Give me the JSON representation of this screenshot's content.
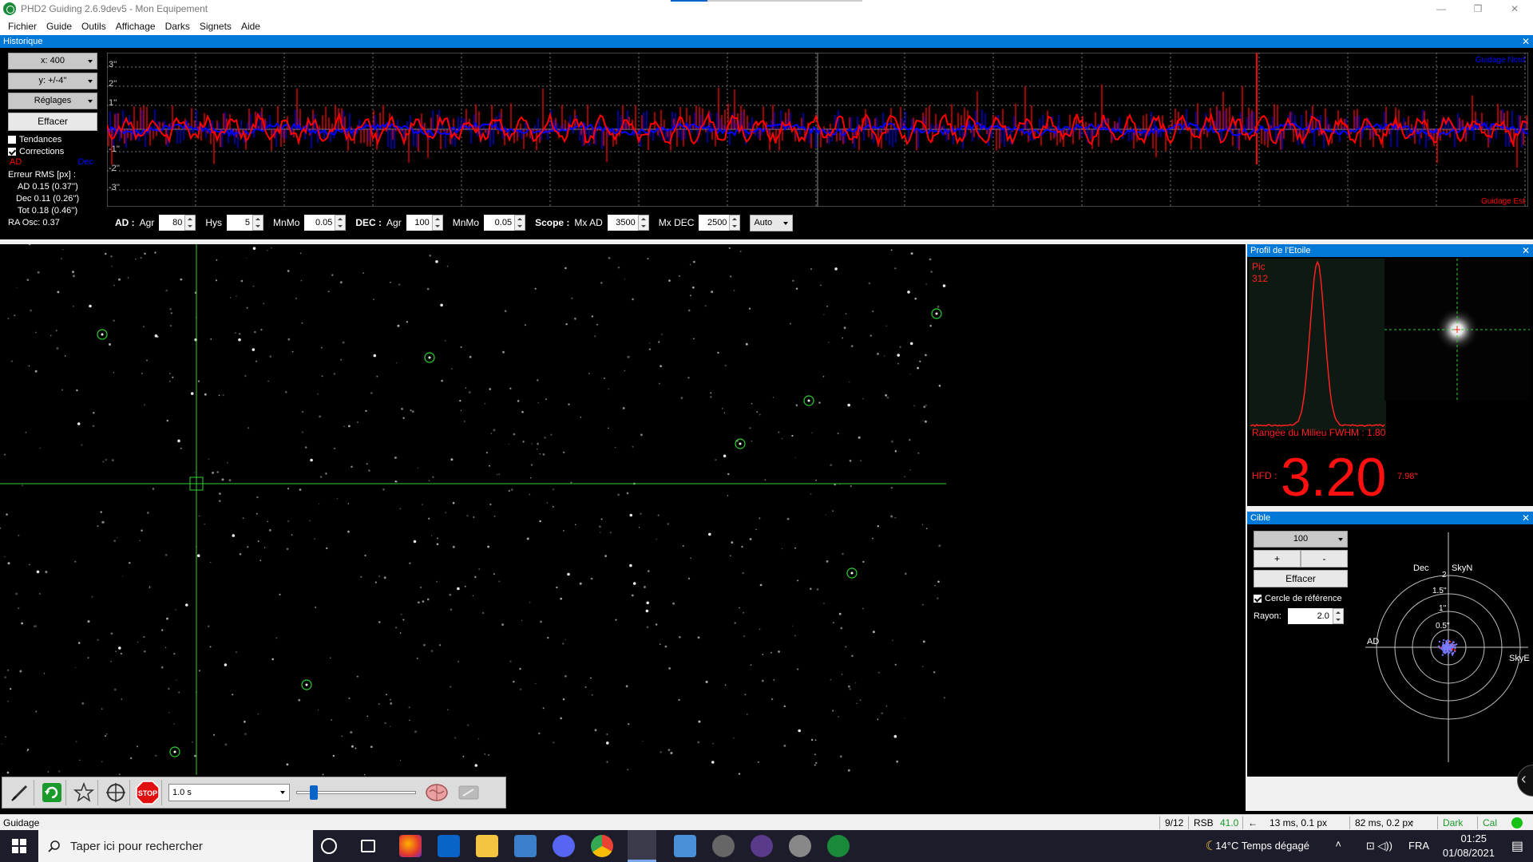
{
  "window": {
    "title": "PHD2 Guiding 2.6.9dev5 - Mon Equipement",
    "controls": [
      "—",
      "❐",
      "✕"
    ]
  },
  "menu": [
    "Fichier",
    "Guide",
    "Outils",
    "Affichage",
    "Darks",
    "Signets",
    "Aide"
  ],
  "history": {
    "title": "Historique",
    "close": "✕",
    "x_scale": "x: 400",
    "y_scale": "y: +/-4''",
    "settings": "Réglages",
    "clear": "Effacer",
    "trends_label": "Tendances",
    "trends_checked": false,
    "corrections_label": "Corrections",
    "corrections_checked": true,
    "legend_ra": "AD",
    "legend_dec": "Dec",
    "rms_title": "Erreur RMS [px] :",
    "rms_ra": "AD 0.15 (0.37'')",
    "rms_dec": "Dec 0.11 (0.26'')",
    "rms_tot": "Tot 0.18 (0.46'')",
    "ra_osc": "RA Osc: 0.37",
    "y_labels": [
      "3''",
      "2''",
      "1''",
      "-1''",
      "-2''",
      "-3''"
    ],
    "corner_top": "Guidage Nord",
    "corner_bottom": "Guidage Est",
    "colors": {
      "ra": "#ff0000",
      "dec": "#0000ff",
      "grid": "#808080"
    }
  },
  "params": {
    "ra_label": "AD :",
    "agr_label": "Agr",
    "ra_agr": "80",
    "hys_label": "Hys",
    "hys": "5",
    "mnmo_label": "MnMo",
    "ra_mnmo": "0.05",
    "dec_label": "DEC :",
    "dec_agr_label": "Agr",
    "dec_agr": "100",
    "dec_mnmo_label": "MnMo",
    "dec_mnmo": "0.05",
    "scope_label": "Scope :",
    "mx_ad_label": "Mx AD",
    "mx_ad": "3500",
    "mx_dec_label": "Mx DEC",
    "mx_dec": "2500",
    "mode": "Auto"
  },
  "toolbar": {
    "exposure": "1.0 s",
    "gamma": 0.12
  },
  "profile": {
    "title": "Profil de l'Etoile",
    "close": "✕",
    "peak_label": "Pic",
    "peak_value": "312",
    "fwhm": "Rangée du Milieu FWHM : 1.80",
    "hfd_label": "HFD :",
    "hfd_value": "3.20",
    "hfd_arcsec": "7.98''"
  },
  "target": {
    "title": "Cible",
    "close": "✕",
    "scale": "100",
    "plus": "+",
    "minus": "-",
    "clear": "Effacer",
    "ref_circle_label": "Cercle de référence",
    "ref_circle_checked": true,
    "radius_label": "Rayon:",
    "radius": "2.0",
    "labels": {
      "dec": "Dec",
      "skyn": "SkyN",
      "ad": "AD",
      "skye": "SkyE",
      "r2": "2",
      "r15": "1.5''",
      "r1": "1''",
      "r05": "0.5''"
    }
  },
  "status": {
    "mode": "Guidage",
    "frames": "9/12",
    "snr_label": "RSB",
    "snr": "41.0",
    "ra_pulse": "13 ms, 0.1 px",
    "dec_pulse": "82 ms, 0.2 px",
    "dark": "Dark",
    "cal": "Cal"
  },
  "taskbar": {
    "search_placeholder": "Taper ici pour rechercher",
    "weather": "14°C  Temps dégagé",
    "lang": "FRA",
    "time": "01:25",
    "date": "01/08/2021"
  }
}
